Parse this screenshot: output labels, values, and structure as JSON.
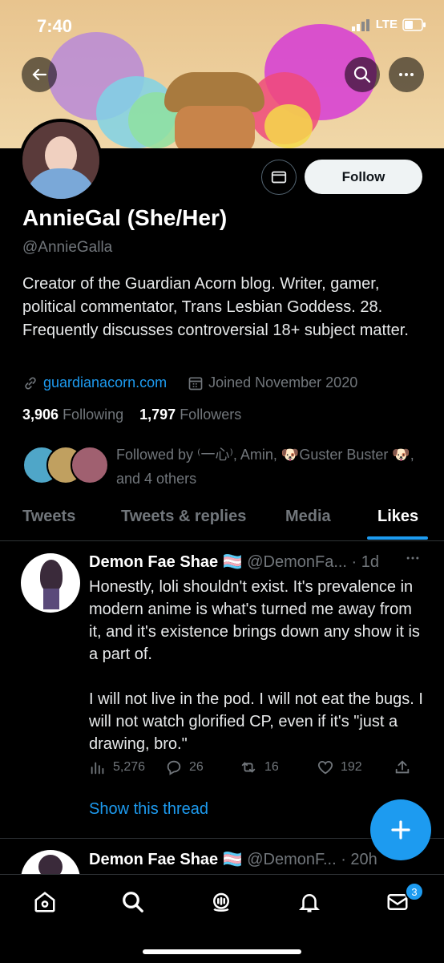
{
  "status": {
    "time": "7:40",
    "network": "LTE"
  },
  "profile": {
    "name": "AnnieGal (She/Her)",
    "handle": "@AnnieGalla",
    "bio": "Creator of the Guardian Acorn blog. Writer, gamer, political commentator, Trans Lesbian Goddess. 28. Frequently discusses controversial 18+ subject matter.",
    "website": "guardianacorn.com",
    "joined": "Joined November 2020",
    "following_count": "3,906",
    "following_label": "Following",
    "followers_count": "1,797",
    "followers_label": "Followers",
    "followed_by": "Followed by ⁽一心⁾, Amin, 🐶Guster Buster 🐶, and 4 others",
    "follow_label": "Follow"
  },
  "tabs": [
    "Tweets",
    "Tweets & replies",
    "Media",
    "Likes"
  ],
  "tweet1": {
    "author": "Demon Fae Shae",
    "flag": "🏳️‍⚧️",
    "handle_time": "@DemonFa... · 1d",
    "text1": "Honestly, loli shouldn't exist. It's prevalence in modern anime is what's turned me away from it, and it's existence brings down any show it is a part of.",
    "text2": "I will not live in the pod. I will not eat the bugs. I will not watch glorified CP, even if it's \"just a drawing, bro.\"",
    "views": "5,276",
    "replies": "26",
    "retweets": "16",
    "likes": "192",
    "show_thread": "Show this thread"
  },
  "tweet2": {
    "author": "Demon Fae Shae",
    "flag": "🏳️‍⚧️",
    "handle_time": "@DemonF... · 20h"
  },
  "nav": {
    "messages_badge": "3"
  },
  "colors": {
    "accent": "#1d9bf0",
    "background": "#000000",
    "muted": "#71767b"
  }
}
